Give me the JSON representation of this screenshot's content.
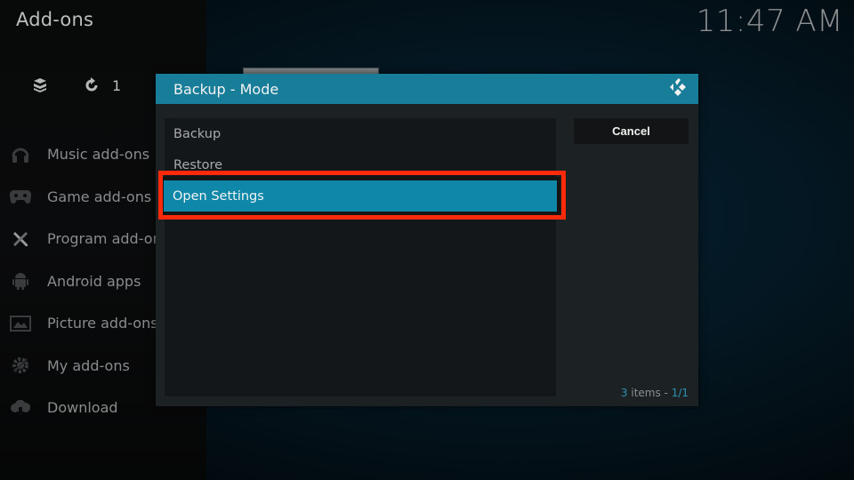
{
  "window": {
    "title": "Add-ons",
    "clock": "11:47 AM"
  },
  "top_bar": {
    "icons": [
      {
        "name": "addon-box-icon"
      },
      {
        "name": "refresh-icon",
        "count": "1"
      }
    ]
  },
  "sidebar": {
    "items": [
      {
        "label": "Music add-ons",
        "icon": "headphones-icon"
      },
      {
        "label": "Game add-ons",
        "icon": "gamepad-icon"
      },
      {
        "label": "Program add-ons",
        "icon": "pencil-ruler-icon"
      },
      {
        "label": "Android apps",
        "icon": "android-icon"
      },
      {
        "label": "Picture add-ons",
        "icon": "picture-icon"
      },
      {
        "label": "My add-ons",
        "icon": "gear-wrench-icon"
      },
      {
        "label": "Download",
        "icon": "cloud-download-icon"
      }
    ]
  },
  "dialog": {
    "title": "Backup - Mode",
    "logo": "kodi-logo-icon",
    "options": [
      {
        "label": "Backup",
        "selected": false
      },
      {
        "label": "Restore",
        "selected": false
      },
      {
        "label": "Open Settings",
        "selected": true
      }
    ],
    "cancel_label": "Cancel",
    "items_count": "3",
    "items_word": " items - ",
    "page": "1/1"
  },
  "colors": {
    "accent": "#187d98",
    "selected": "#0f87a8",
    "highlight_annotation": "#ff2a0a"
  }
}
